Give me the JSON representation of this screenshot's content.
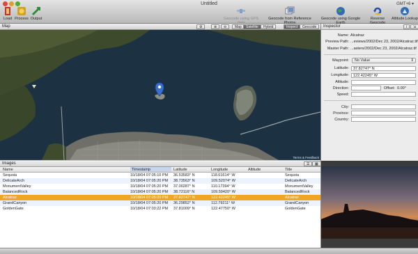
{
  "window": {
    "title": "Untitled",
    "timezone": "GMT+6 ▾"
  },
  "toolbar": {
    "load": "Load",
    "process": "Process",
    "output": "Output",
    "geocode_gps": "Geocode using GPS data",
    "geocode_reference": "Geocode from Reference Photos",
    "geocode_google_earth": "Geocode using Google Earth",
    "reverse_geocode": "Reverse Geocode",
    "altitude_lookup": "Altitude Lookup"
  },
  "map": {
    "label": "Map",
    "view_modes": [
      "Map",
      "Satellite",
      "Hybrid"
    ],
    "selected_view": "Satellite",
    "inspect_label": "Inspect",
    "geocode_label": "Geocode",
    "attribution": "Terms & Feedback"
  },
  "images": {
    "label": "Images",
    "columns": [
      "Name",
      "Timestamp",
      "Latitude",
      "Longitude",
      "Altitude",
      "Title"
    ],
    "rows": [
      {
        "name": "Sequoia",
        "timestamp": "10/18/04 07:05:10 PM",
        "lat": "36.53583° N",
        "lon": "118.61614° W",
        "alt": "",
        "title": "Sequoia"
      },
      {
        "name": "DelicateArch",
        "timestamp": "10/18/04 07:05:20 PM",
        "lat": "38.73563° N",
        "lon": "109.52074° W",
        "alt": "",
        "title": "DelicateArch"
      },
      {
        "name": "MonumentValley",
        "timestamp": "10/18/04 07:05:20 PM",
        "lat": "37.00287° N",
        "lon": "110.17394° W",
        "alt": "",
        "title": "MonumentValley"
      },
      {
        "name": "BalancedRock",
        "timestamp": "10/18/04 07:05:20 PM",
        "lat": "38.72116° N",
        "lon": "109.59420° W",
        "alt": "",
        "title": "BalancedRock"
      },
      {
        "name": "Alcatraz",
        "timestamp": "10/18/04 07:05:20 PM",
        "lat": "37.82747° N",
        "lon": "122.42245° W",
        "alt": "",
        "title": "Alcatraz"
      },
      {
        "name": "GrandCanyon",
        "timestamp": "10/18/04 07:05:20 PM",
        "lat": "36.29852° N",
        "lon": "112.79211° W",
        "alt": "",
        "title": "GrandCanyon"
      },
      {
        "name": "GoldenGate",
        "timestamp": "10/18/04 07:03:22 PM",
        "lat": "37.81009° N",
        "lon": "122.47750° W",
        "alt": "",
        "title": "GoldenGate"
      }
    ],
    "selected_index": 4
  },
  "inspector": {
    "label": "Inspector",
    "name_label": "Name:",
    "name": "Alcatraz",
    "preview_path_label": "Preview Path:",
    "preview_path": "...eviews/2002/Dec 23, 2002/Alcatraz.tif",
    "master_path_label": "Master Path:",
    "master_path": "...asters/2002/Dec 23, 2002/Alcatraz.tif",
    "waypoint_label": "Waypoint:",
    "waypoint": "No Value",
    "latitude_label": "Latitude:",
    "latitude": "37.82747° N",
    "longitude_label": "Longitude:",
    "longitude": "122.42245° W",
    "altitude_label": "Altitude:",
    "direction_label": "Direction:",
    "offset_label": "Offset:",
    "offset": "0.00°",
    "speed_label": "Speed:",
    "city_label": "City:",
    "province_label": "Province:",
    "country_label": "Country:"
  }
}
